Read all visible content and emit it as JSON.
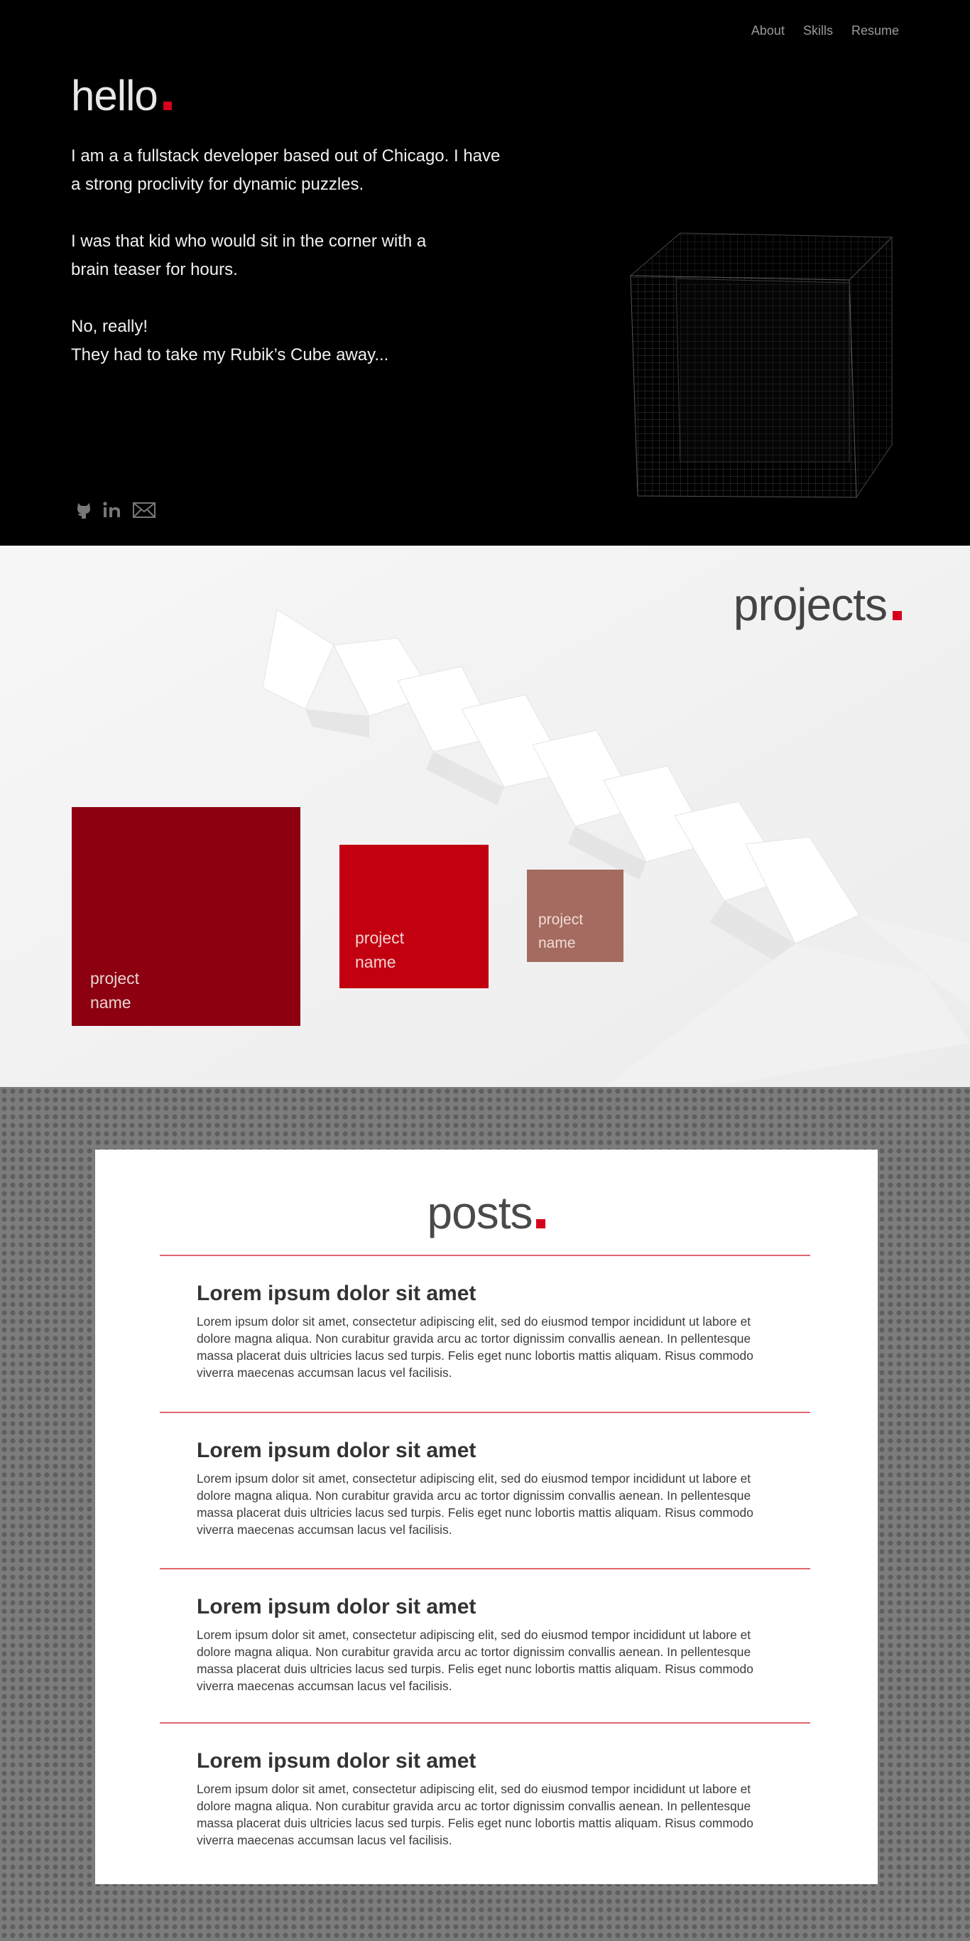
{
  "nav": {
    "items": [
      "About",
      "Skills",
      "Resume"
    ]
  },
  "hero": {
    "title": "hello",
    "paragraphs": [
      "I am a a fullstack developer based out of Chicago. I have a strong proclivity for dynamic puzzles.",
      "I was that kid who would sit in the corner with a brain teaser for hours.",
      "No, really!\nThey had to take my Rubik’s Cube away..."
    ],
    "social": [
      "github-icon",
      "linkedin-icon",
      "mail-icon"
    ]
  },
  "projects": {
    "title": "projects",
    "cards": [
      "project name",
      "project name",
      "project name"
    ]
  },
  "posts": {
    "title": "posts",
    "items": [
      {
        "title": "Lorem ipsum dolor sit amet",
        "body": "Lorem ipsum dolor sit amet, consectetur adipiscing elit, sed do eiusmod tempor incididunt ut labore et dolore magna aliqua. Non curabitur gravida arcu ac tortor dignissim convallis aenean. In pellentesque massa placerat duis ultricies lacus sed turpis. Felis eget nunc lobortis mattis aliquam. Risus commodo viverra maecenas accumsan lacus vel facilisis."
      },
      {
        "title": "Lorem ipsum dolor sit amet",
        "body": "Lorem ipsum dolor sit amet, consectetur adipiscing elit, sed do eiusmod tempor incididunt ut labore et dolore magna aliqua. Non curabitur gravida arcu ac tortor dignissim convallis aenean. In pellentesque massa placerat duis ultricies lacus sed turpis. Felis eget nunc lobortis mattis aliquam. Risus commodo viverra maecenas accumsan lacus vel facilisis."
      },
      {
        "title": "Lorem ipsum dolor sit amet",
        "body": "Lorem ipsum dolor sit amet, consectetur adipiscing elit, sed do eiusmod tempor incididunt ut labore et dolore magna aliqua. Non curabitur gravida arcu ac tortor dignissim convallis aenean. In pellentesque massa placerat duis ultricies lacus sed turpis. Felis eget nunc lobortis mattis aliquam. Risus commodo viverra maecenas accumsan lacus vel facilisis."
      },
      {
        "title": "Lorem ipsum dolor sit amet",
        "body": "Lorem ipsum dolor sit amet, consectetur adipiscing elit, sed do eiusmod tempor incididunt ut labore et dolore magna aliqua. Non curabitur gravida arcu ac tortor dignissim convallis aenean. In pellentesque massa placerat duis ultricies lacus sed turpis. Felis eget nunc lobortis mattis aliquam. Risus commodo viverra maecenas accumsan lacus vel facilisis."
      }
    ]
  },
  "colors": {
    "accent": "#d6001c",
    "card_dark": "#8c0010",
    "card_mid": "#c20010",
    "card_muted": "#a56b60",
    "divider": "#e06670"
  }
}
